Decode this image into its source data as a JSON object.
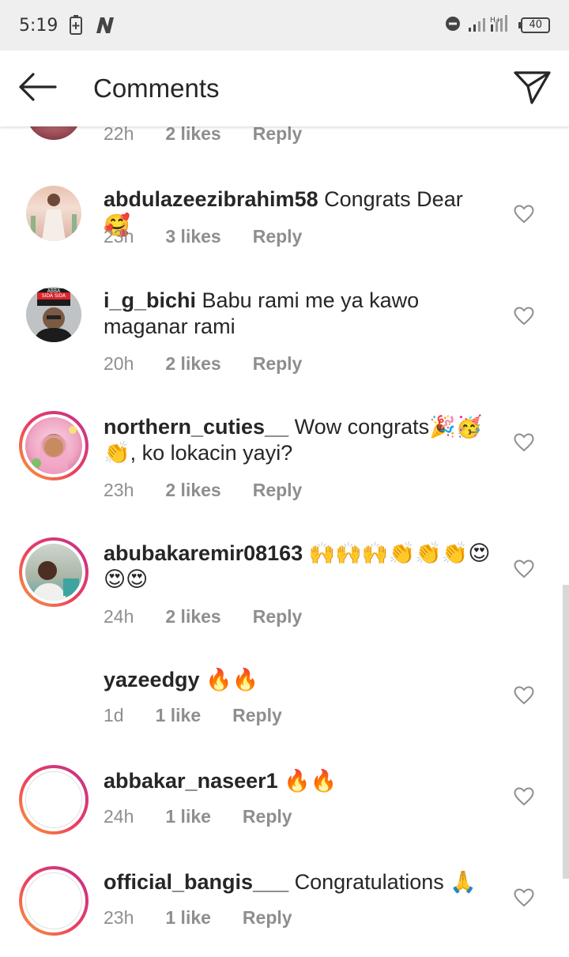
{
  "status_bar": {
    "time": "5:19",
    "battery": "40"
  },
  "header": {
    "title": "Comments"
  },
  "partial_comment": {
    "time": "22h",
    "likes": "2 likes",
    "reply": "Reply"
  },
  "comments": [
    {
      "username": "abdulazeezibrahim58",
      "text": "Congrats Dear 🥰",
      "time": "23h",
      "likes": "3 likes",
      "reply": "Reply",
      "avatar": "photo"
    },
    {
      "username": "i_g_bichi",
      "text": "Babu rami me ya kawo maganar rami",
      "time": "20h",
      "likes": "2 likes",
      "reply": "Reply",
      "avatar": "photo",
      "avatar_text": [
        "ABBA",
        "SIDA SIDA"
      ]
    },
    {
      "username": "northern_cuties__",
      "text": "Wow congrats🎉🥳👏, ko lokacin yayi?",
      "time": "23h",
      "likes": "2 likes",
      "reply": "Reply",
      "avatar": "story-ring"
    },
    {
      "username": "abubakaremir08163",
      "text": "🙌🙌🙌👏👏👏😍😍😍",
      "time": "24h",
      "likes": "2 likes",
      "reply": "Reply",
      "avatar": "story-ring"
    },
    {
      "username": "yazeedgy",
      "text": "🔥🔥",
      "time": "1d",
      "likes": "1 like",
      "reply": "Reply",
      "avatar": "empty"
    },
    {
      "username": "abbakar_naseer1",
      "text": "🔥🔥",
      "time": "24h",
      "likes": "1 like",
      "reply": "Reply",
      "avatar": "story-ring-empty"
    },
    {
      "username": "official_bangis___",
      "text": "Congratulations 🙏",
      "time": "23h",
      "likes": "1 like",
      "reply": "Reply",
      "avatar": "story-ring-empty"
    }
  ],
  "colors": {
    "story_ring_start": "#f9a13a",
    "story_ring_end": "#c1318e",
    "meta_text": "#8e8e8e"
  }
}
